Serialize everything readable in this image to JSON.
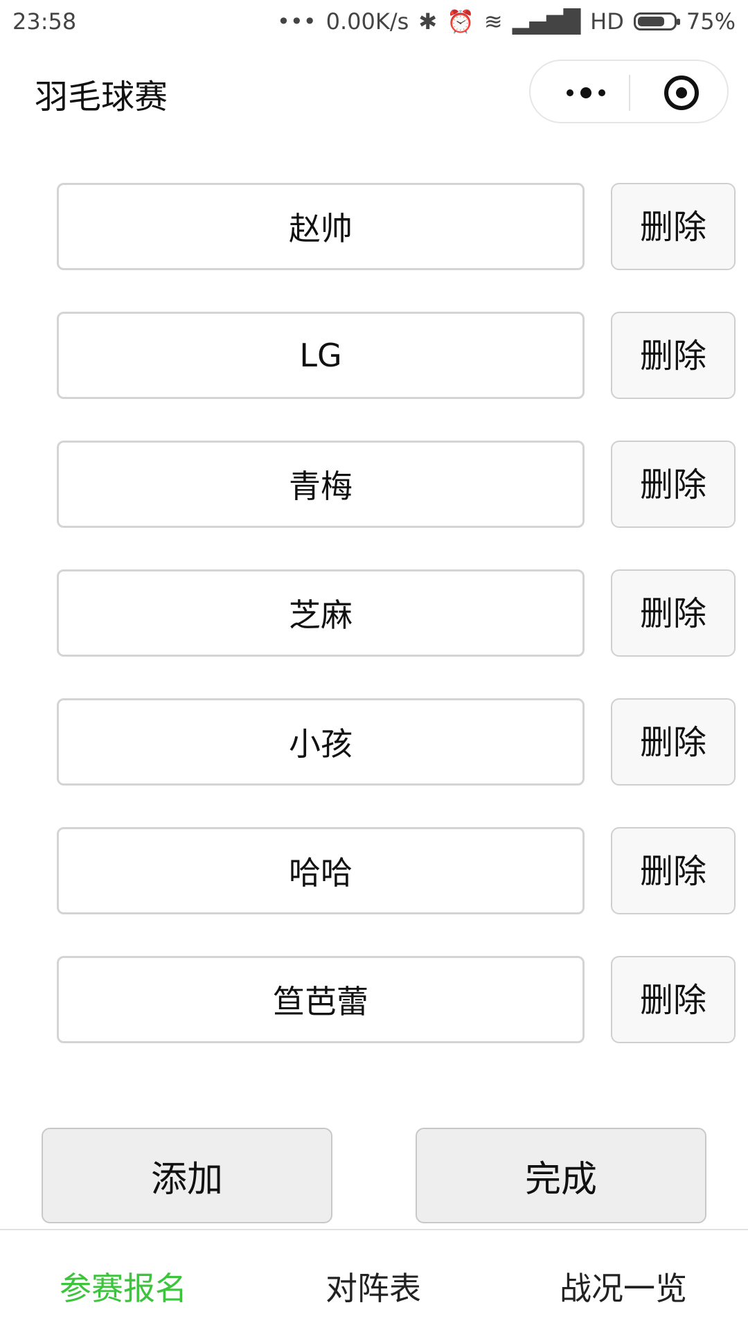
{
  "status_bar": {
    "time": "23:58",
    "network_speed": "0.00K/s",
    "network_type": "HD",
    "battery": "75%"
  },
  "nav": {
    "title": "羽毛球赛"
  },
  "players": [
    {
      "name": "赵帅",
      "delete_label": "删除"
    },
    {
      "name": "LG",
      "delete_label": "删除"
    },
    {
      "name": "青梅",
      "delete_label": "删除"
    },
    {
      "name": "芝麻",
      "delete_label": "删除"
    },
    {
      "name": "小孩",
      "delete_label": "删除"
    },
    {
      "name": "哈哈",
      "delete_label": "删除"
    },
    {
      "name": "笪芭蕾",
      "delete_label": "删除"
    }
  ],
  "actions": {
    "add_label": "添加",
    "done_label": "完成"
  },
  "tabs": [
    {
      "label": "参赛报名",
      "active": true
    },
    {
      "label": "对阵表",
      "active": false
    },
    {
      "label": "战况一览",
      "active": false
    }
  ],
  "colors": {
    "active_tab": "#3cc43c",
    "button_bg": "#eeeeee"
  }
}
